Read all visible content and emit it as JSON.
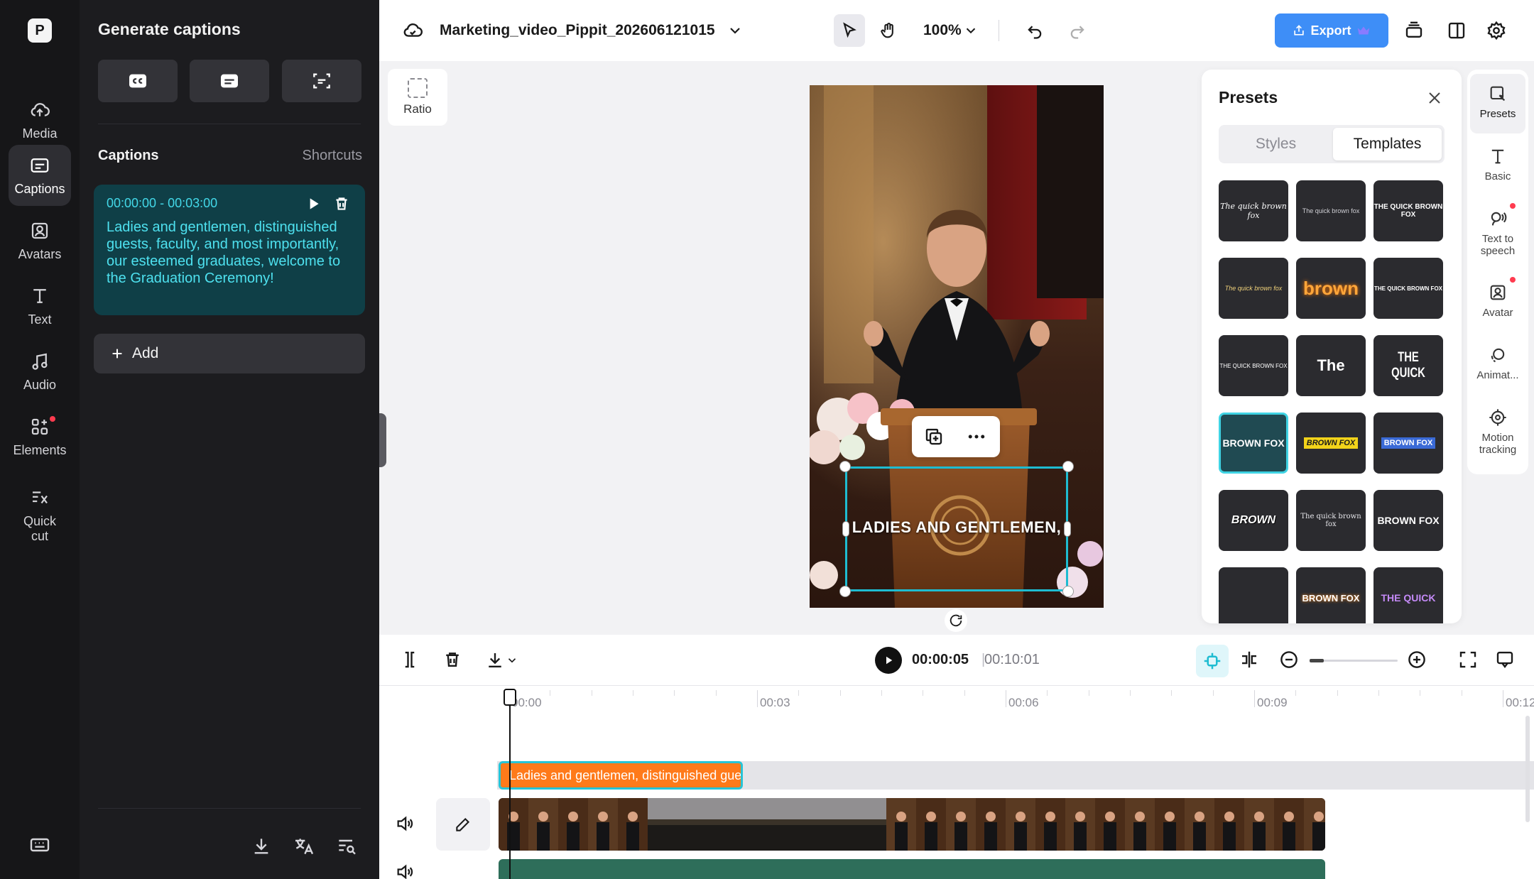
{
  "rail": {
    "items": [
      {
        "label": "Media",
        "icon": "cloud-upload-icon"
      },
      {
        "label": "Captions",
        "icon": "captions-icon"
      },
      {
        "label": "Avatars",
        "icon": "avatar-icon"
      },
      {
        "label": "Text",
        "icon": "text-icon"
      },
      {
        "label": "Audio",
        "icon": "music-note-icon"
      },
      {
        "label": "Elements",
        "icon": "elements-icon"
      },
      {
        "label": "Quick\ncut",
        "icon": "quick-cut-icon"
      }
    ],
    "active": "Captions"
  },
  "panel": {
    "title": "Generate captions",
    "captions_title": "Captions",
    "shortcuts": "Shortcuts",
    "caption": {
      "time": "00:00:00 - 00:03:00",
      "text": "Ladies and gentlemen, distinguished guests, faculty, and most importantly, our esteemed graduates, welcome to the Graduation  Ceremony!"
    },
    "add_label": "Add"
  },
  "topbar": {
    "project_name": "Marketing_video_Pippit_202606121015",
    "zoom": "100%",
    "export_label": "Export"
  },
  "canvas": {
    "ratio_label": "Ratio",
    "caption_overlay": "LADIES AND GENTLEMEN,"
  },
  "presets": {
    "title": "Presets",
    "tabs": [
      "Styles",
      "Templates"
    ],
    "active_tab": "Templates",
    "templates": [
      "The quick brown fox",
      "The quick brown fox",
      "THE QUICK BROWN FOX",
      "The quick brown fox",
      "brown",
      "THE QUICK BROWN FOX",
      "THE QUICK BROWN FOX",
      "The",
      "THE QUICK",
      "BROWN FOX",
      "BROWN FOX",
      "BROWN FOX",
      "BROWN",
      "The quick brown fox",
      "BROWN FOX",
      "",
      "BROWN FOX",
      "THE QUICK"
    ]
  },
  "right_rail": {
    "items": [
      {
        "label": "Presets",
        "icon": "presets-icon"
      },
      {
        "label": "Basic",
        "icon": "text-basic-icon"
      },
      {
        "label": "Text to\nspeech",
        "icon": "text-to-speech-icon"
      },
      {
        "label": "Avatar",
        "icon": "avatar-icon"
      },
      {
        "label": "Animat...",
        "icon": "animation-icon"
      },
      {
        "label": "Motion\ntracking",
        "icon": "motion-tracking-icon"
      }
    ]
  },
  "timeline": {
    "current_time": "00:00:05",
    "separator": "|",
    "total_time": "00:10:01",
    "ticks": [
      "00:00",
      "00:03",
      "00:06",
      "00:09",
      "00:12"
    ],
    "caption_clip": "Ladies and gentlemen, distinguished guests, faculty, and most importantly"
  },
  "colors": {
    "accent": "#3e8ef7",
    "caption_cyan": "#43d8e8",
    "caption_clip": "#ff7a1a",
    "selection": "#1ebcd1"
  }
}
